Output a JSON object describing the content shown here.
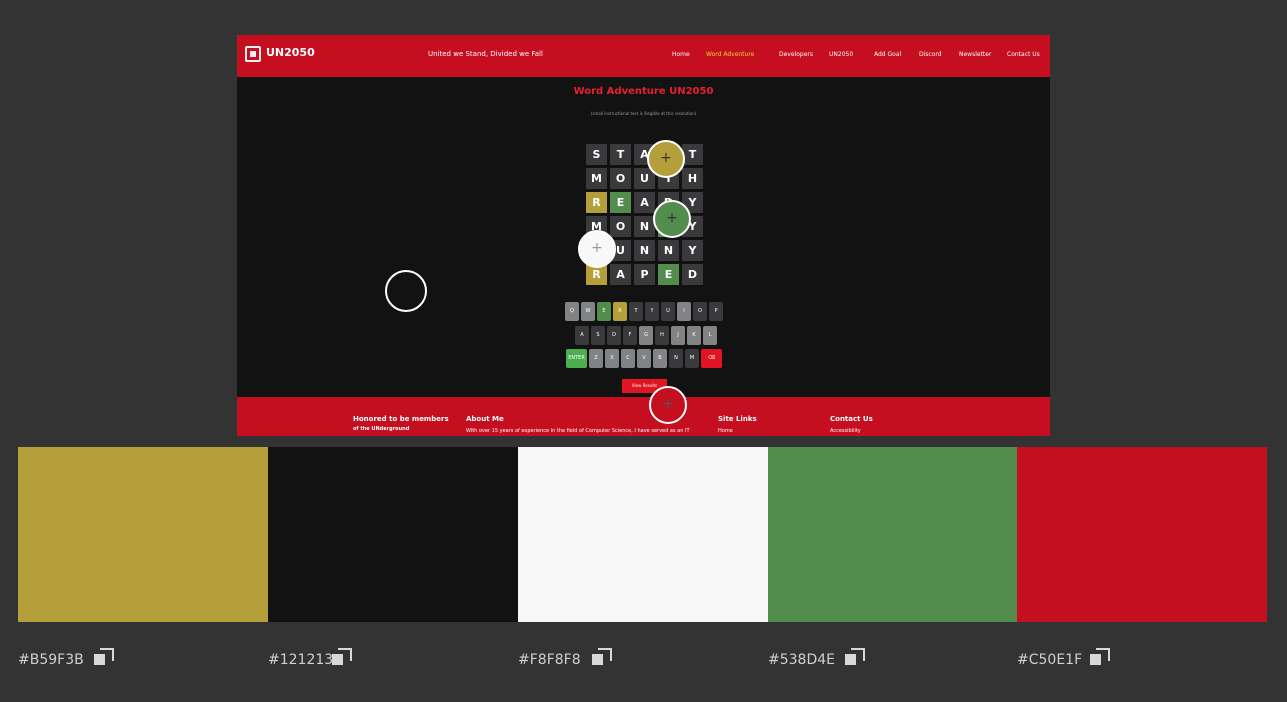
{
  "preview": {
    "logo_text": "UN2050",
    "tagline": "United we Stand, Divided we Fall",
    "nav": [
      "Home",
      "Word Adventure",
      "Developers",
      "UN2050",
      "Add Goal",
      "Discord",
      "Newsletter",
      "Contact Us"
    ],
    "title": "Word Adventure UN2050",
    "instructions": "(small instructional text is illegible at this resolution)",
    "grid": [
      [
        {
          "l": "S",
          "s": ""
        },
        {
          "l": "T",
          "s": ""
        },
        {
          "l": "A",
          "s": ""
        },
        {
          "l": "R",
          "s": ""
        },
        {
          "l": "T",
          "s": ""
        }
      ],
      [
        {
          "l": "M",
          "s": ""
        },
        {
          "l": "O",
          "s": ""
        },
        {
          "l": "U",
          "s": ""
        },
        {
          "l": "T",
          "s": ""
        },
        {
          "l": "H",
          "s": ""
        }
      ],
      [
        {
          "l": "R",
          "s": "y"
        },
        {
          "l": "E",
          "s": "g"
        },
        {
          "l": "A",
          "s": ""
        },
        {
          "l": "D",
          "s": ""
        },
        {
          "l": "Y",
          "s": ""
        }
      ],
      [
        {
          "l": "M",
          "s": ""
        },
        {
          "l": "O",
          "s": ""
        },
        {
          "l": "N",
          "s": ""
        },
        {
          "l": "E",
          "s": "g"
        },
        {
          "l": "Y",
          "s": ""
        }
      ],
      [
        {
          "l": "S",
          "s": ""
        },
        {
          "l": "U",
          "s": ""
        },
        {
          "l": "N",
          "s": ""
        },
        {
          "l": "N",
          "s": ""
        },
        {
          "l": "Y",
          "s": ""
        }
      ],
      [
        {
          "l": "R",
          "s": "y"
        },
        {
          "l": "A",
          "s": ""
        },
        {
          "l": "P",
          "s": ""
        },
        {
          "l": "E",
          "s": "g"
        },
        {
          "l": "D",
          "s": ""
        }
      ]
    ],
    "keyboard": [
      [
        {
          "k": "Q",
          "s": ""
        },
        {
          "k": "W",
          "s": ""
        },
        {
          "k": "E",
          "s": "g"
        },
        {
          "k": "R",
          "s": "y"
        },
        {
          "k": "T",
          "s": "d"
        },
        {
          "k": "Y",
          "s": "d"
        },
        {
          "k": "U",
          "s": "d"
        },
        {
          "k": "I",
          "s": ""
        },
        {
          "k": "O",
          "s": "d"
        },
        {
          "k": "P",
          "s": "d"
        }
      ],
      [
        {
          "k": "A",
          "s": "d"
        },
        {
          "k": "S",
          "s": "d"
        },
        {
          "k": "D",
          "s": "d"
        },
        {
          "k": "F",
          "s": "d"
        },
        {
          "k": "G",
          "s": ""
        },
        {
          "k": "H",
          "s": "d"
        },
        {
          "k": "J",
          "s": ""
        },
        {
          "k": "K",
          "s": ""
        },
        {
          "k": "L",
          "s": ""
        }
      ],
      [
        {
          "k": "ENTER",
          "s": "enter"
        },
        {
          "k": "Z",
          "s": ""
        },
        {
          "k": "X",
          "s": ""
        },
        {
          "k": "C",
          "s": ""
        },
        {
          "k": "V",
          "s": ""
        },
        {
          "k": "B",
          "s": ""
        },
        {
          "k": "N",
          "s": "d"
        },
        {
          "k": "M",
          "s": "d"
        },
        {
          "k": "⌫",
          "s": "del"
        }
      ]
    ],
    "small_button": "View Results",
    "footer": {
      "honored_line1": "Honored to be members",
      "honored_line2": "of the UNderground",
      "about_title": "About Me",
      "about_text": "With over 15 years of experience in the field of Computer Science, I have served as an IT",
      "links_title": "Site Links",
      "links_item": "Home",
      "contact_title": "Contact Us",
      "contact_item": "Accessibility"
    }
  },
  "palette": [
    {
      "hex": "#B59F3B",
      "color": "#B59F3B"
    },
    {
      "hex": "#121213",
      "color": "#121213"
    },
    {
      "hex": "#F8F8F8",
      "color": "#F8F8F8"
    },
    {
      "hex": "#538D4E",
      "color": "#538D4E"
    },
    {
      "hex": "#C50E1F",
      "color": "#C50E1F"
    }
  ]
}
